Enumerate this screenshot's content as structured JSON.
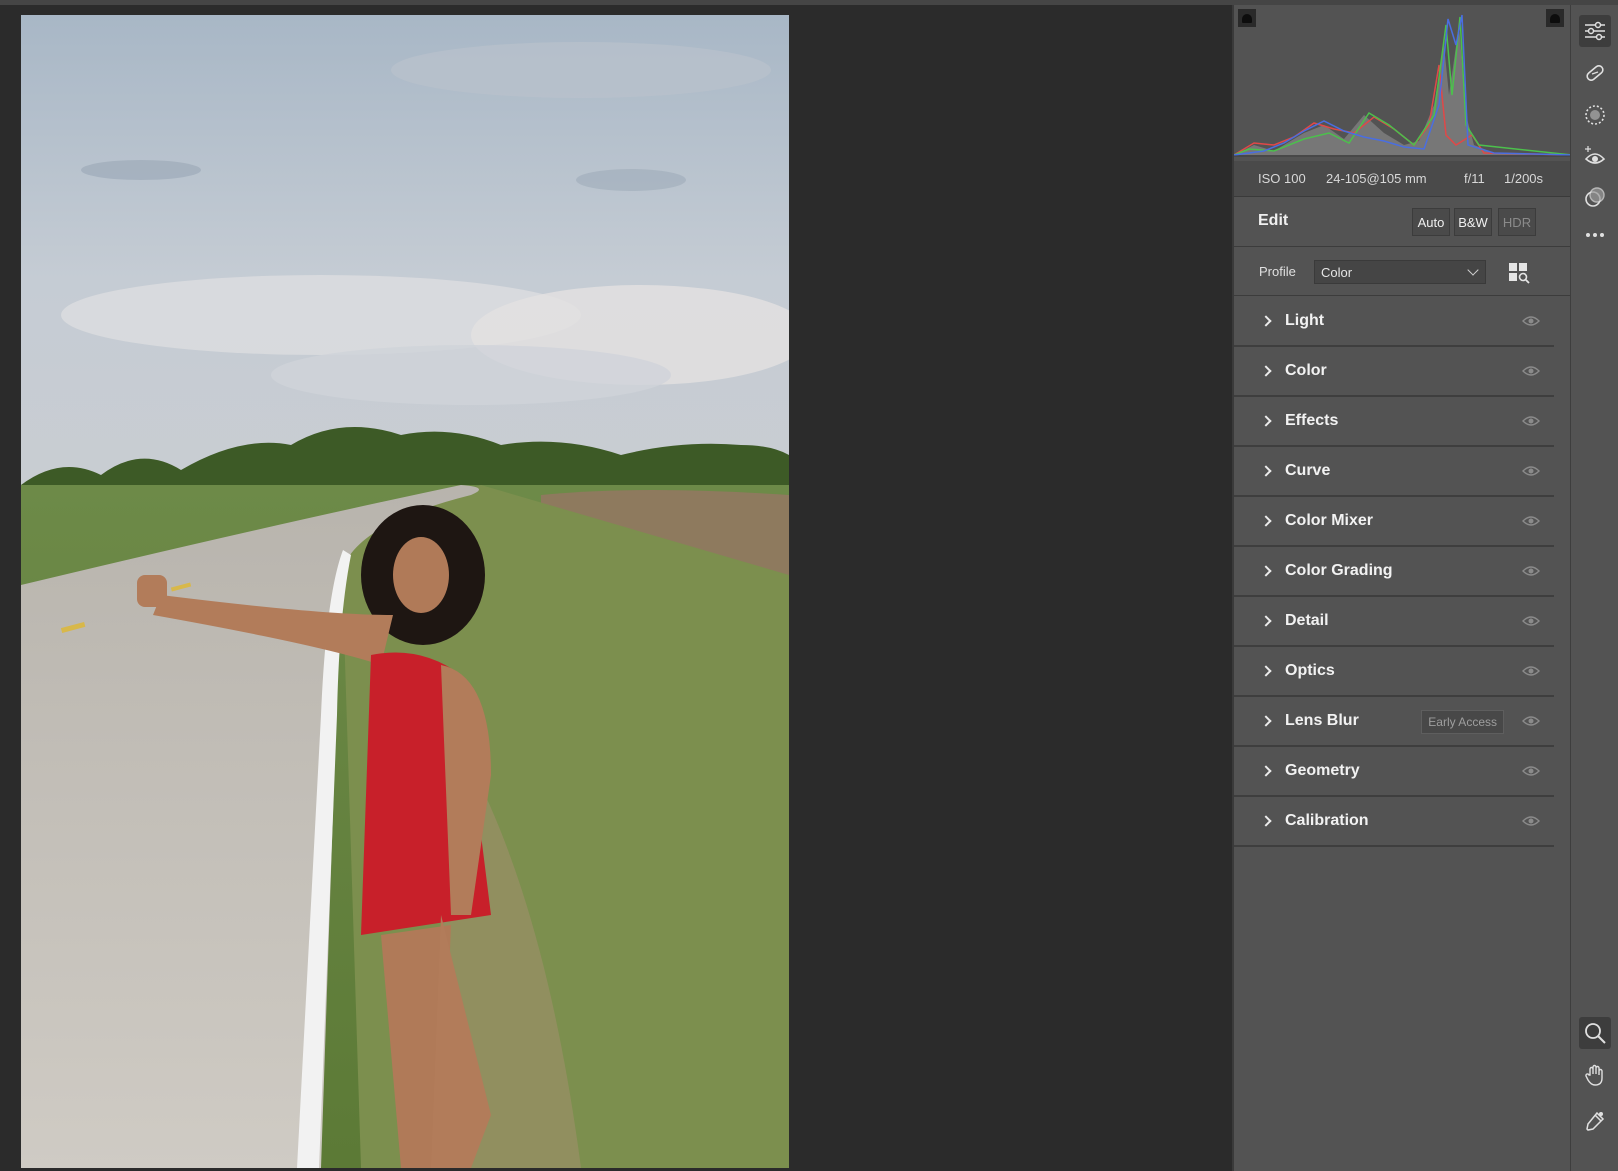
{
  "exif": {
    "iso": "ISO 100",
    "lens": "24-105@105 mm",
    "aperture": "f/11",
    "shutter": "1/200s"
  },
  "edit": {
    "title": "Edit",
    "auto_label": "Auto",
    "bw_label": "B&W",
    "hdr_label": "HDR"
  },
  "profile": {
    "label": "Profile",
    "value": "Color"
  },
  "sections": [
    {
      "label": "Light"
    },
    {
      "label": "Color"
    },
    {
      "label": "Effects"
    },
    {
      "label": "Curve"
    },
    {
      "label": "Color Mixer"
    },
    {
      "label": "Color Grading"
    },
    {
      "label": "Detail"
    },
    {
      "label": "Optics"
    },
    {
      "label": "Lens Blur",
      "badge": "Early Access"
    },
    {
      "label": "Geometry"
    },
    {
      "label": "Calibration"
    }
  ],
  "toolbar": {
    "icons": [
      "sliders-icon",
      "healing-icon",
      "masking-icon",
      "red-eye-icon",
      "presets-icon",
      "more-icon",
      "zoom-icon",
      "hand-icon",
      "eyedropper-icon"
    ]
  },
  "colors": {
    "panel_bg": "#535353",
    "canvas_bg": "#2b2b2b",
    "histogram_red": "#e04848",
    "histogram_green": "#4cc04c",
    "histogram_blue": "#4a6ee0"
  }
}
